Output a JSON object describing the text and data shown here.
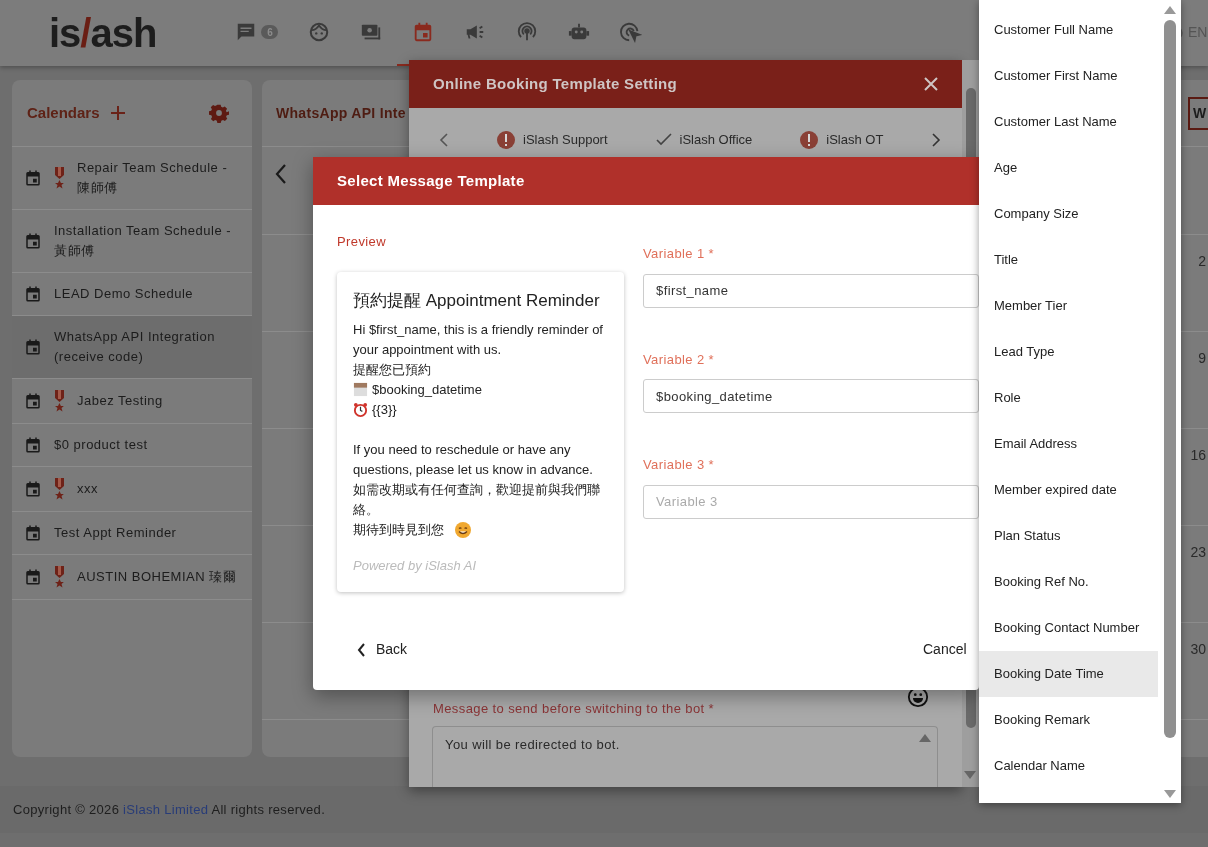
{
  "header": {
    "logo": [
      "is",
      "/",
      "ash"
    ],
    "nav": [
      {
        "kind": "chat",
        "badge": "6",
        "selected": false
      },
      {
        "kind": "face",
        "selected": false
      },
      {
        "kind": "screen",
        "selected": false
      },
      {
        "kind": "calendar",
        "selected": true
      },
      {
        "kind": "megaphone",
        "selected": false
      },
      {
        "kind": "broadcast",
        "selected": false
      },
      {
        "kind": "robot",
        "selected": false
      },
      {
        "kind": "cursor",
        "selected": false
      }
    ],
    "language": "EN"
  },
  "calendars": {
    "title": "Calendars",
    "items": [
      {
        "name": "Repair Team Schedule - 陳師傅",
        "medal": true,
        "selected": false
      },
      {
        "name": "Installation Team Schedule - 黃師傅",
        "medal": false,
        "selected": false
      },
      {
        "name": "LEAD Demo Schedule",
        "medal": false,
        "selected": false
      },
      {
        "name": "WhatsApp API Integration (receive code)",
        "medal": false,
        "selected": true
      },
      {
        "name": "Jabez Testing",
        "medal": true,
        "selected": false
      },
      {
        "name": "$0 product test",
        "medal": false,
        "selected": false
      },
      {
        "name": "xxx",
        "medal": true,
        "selected": false
      },
      {
        "name": "Test Appt Reminder",
        "medal": false,
        "selected": false
      },
      {
        "name": "AUSTIN BOHEMIAN 瑧爾",
        "medal": true,
        "selected": false
      }
    ]
  },
  "calendar_view": {
    "title": "WhatsApp API Inte",
    "weekday": "W",
    "days": [
      "2",
      "9",
      "16",
      "23",
      "30"
    ]
  },
  "booking_modal": {
    "title": "Online Booking Template Setting",
    "steps": [
      {
        "label": "iSlash Support",
        "kind": "warning"
      },
      {
        "label": "iSlash Office",
        "kind": "done"
      },
      {
        "label": "iSlash OT",
        "kind": "warning"
      }
    ],
    "message_label": "Message to send before switching to the bot *",
    "message": "You will be redirected to bot."
  },
  "template_modal": {
    "title": "Select Message Template",
    "preview_label": "Preview",
    "preview": {
      "title": "預約提醒 Appointment Reminder",
      "lines": [
        {
          "text": "Hi $first_name, this is a friendly reminder of your appointment with us.",
          "kind": "plain"
        },
        {
          "text": "提醒您已預約",
          "kind": "plain"
        },
        {
          "text": "$booking_datetime",
          "kind": "date"
        },
        {
          "text": "{{3}}",
          "kind": "time"
        },
        {
          "text": "If you need to reschedule or have any questions, please let us know in advance.",
          "kind": "paragraph"
        },
        {
          "text": "如需改期或有任何查詢，歡迎提前與我們聯絡。",
          "kind": "plain"
        },
        {
          "text": "期待到時見到您",
          "kind": "closing"
        }
      ],
      "footer": "Powered by iSlash AI"
    },
    "variables": [
      {
        "label": "Variable 1 *",
        "value": "$first_name"
      },
      {
        "label": "Variable 2 *",
        "value": "$booking_datetime"
      },
      {
        "label": "Variable 3 *",
        "placeholder": "Variable 3"
      }
    ],
    "back": "Back",
    "cancel": "Cancel"
  },
  "variable_menu": {
    "items": [
      {
        "label": "Customer Full Name",
        "selected": false
      },
      {
        "label": "Customer First Name",
        "selected": false
      },
      {
        "label": "Customer Last Name",
        "selected": false
      },
      {
        "label": "Age",
        "selected": false
      },
      {
        "label": "Company Size",
        "selected": false
      },
      {
        "label": "Title",
        "selected": false
      },
      {
        "label": "Member Tier",
        "selected": false
      },
      {
        "label": "Lead Type",
        "selected": false
      },
      {
        "label": "Role",
        "selected": false
      },
      {
        "label": "Email Address",
        "selected": false
      },
      {
        "label": "Member expired date",
        "selected": false
      },
      {
        "label": "Plan Status",
        "selected": false
      },
      {
        "label": "Booking Ref No.",
        "selected": false
      },
      {
        "label": "Booking Contact Number",
        "selected": false
      },
      {
        "label": "Booking Date Time",
        "selected": true
      },
      {
        "label": "Booking Remark",
        "selected": false
      },
      {
        "label": "Calendar Name",
        "selected": false
      }
    ]
  },
  "footer": {
    "before": "Copyright © 2026",
    "link": "iSlash Limited",
    "after": "All rights reserved."
  }
}
